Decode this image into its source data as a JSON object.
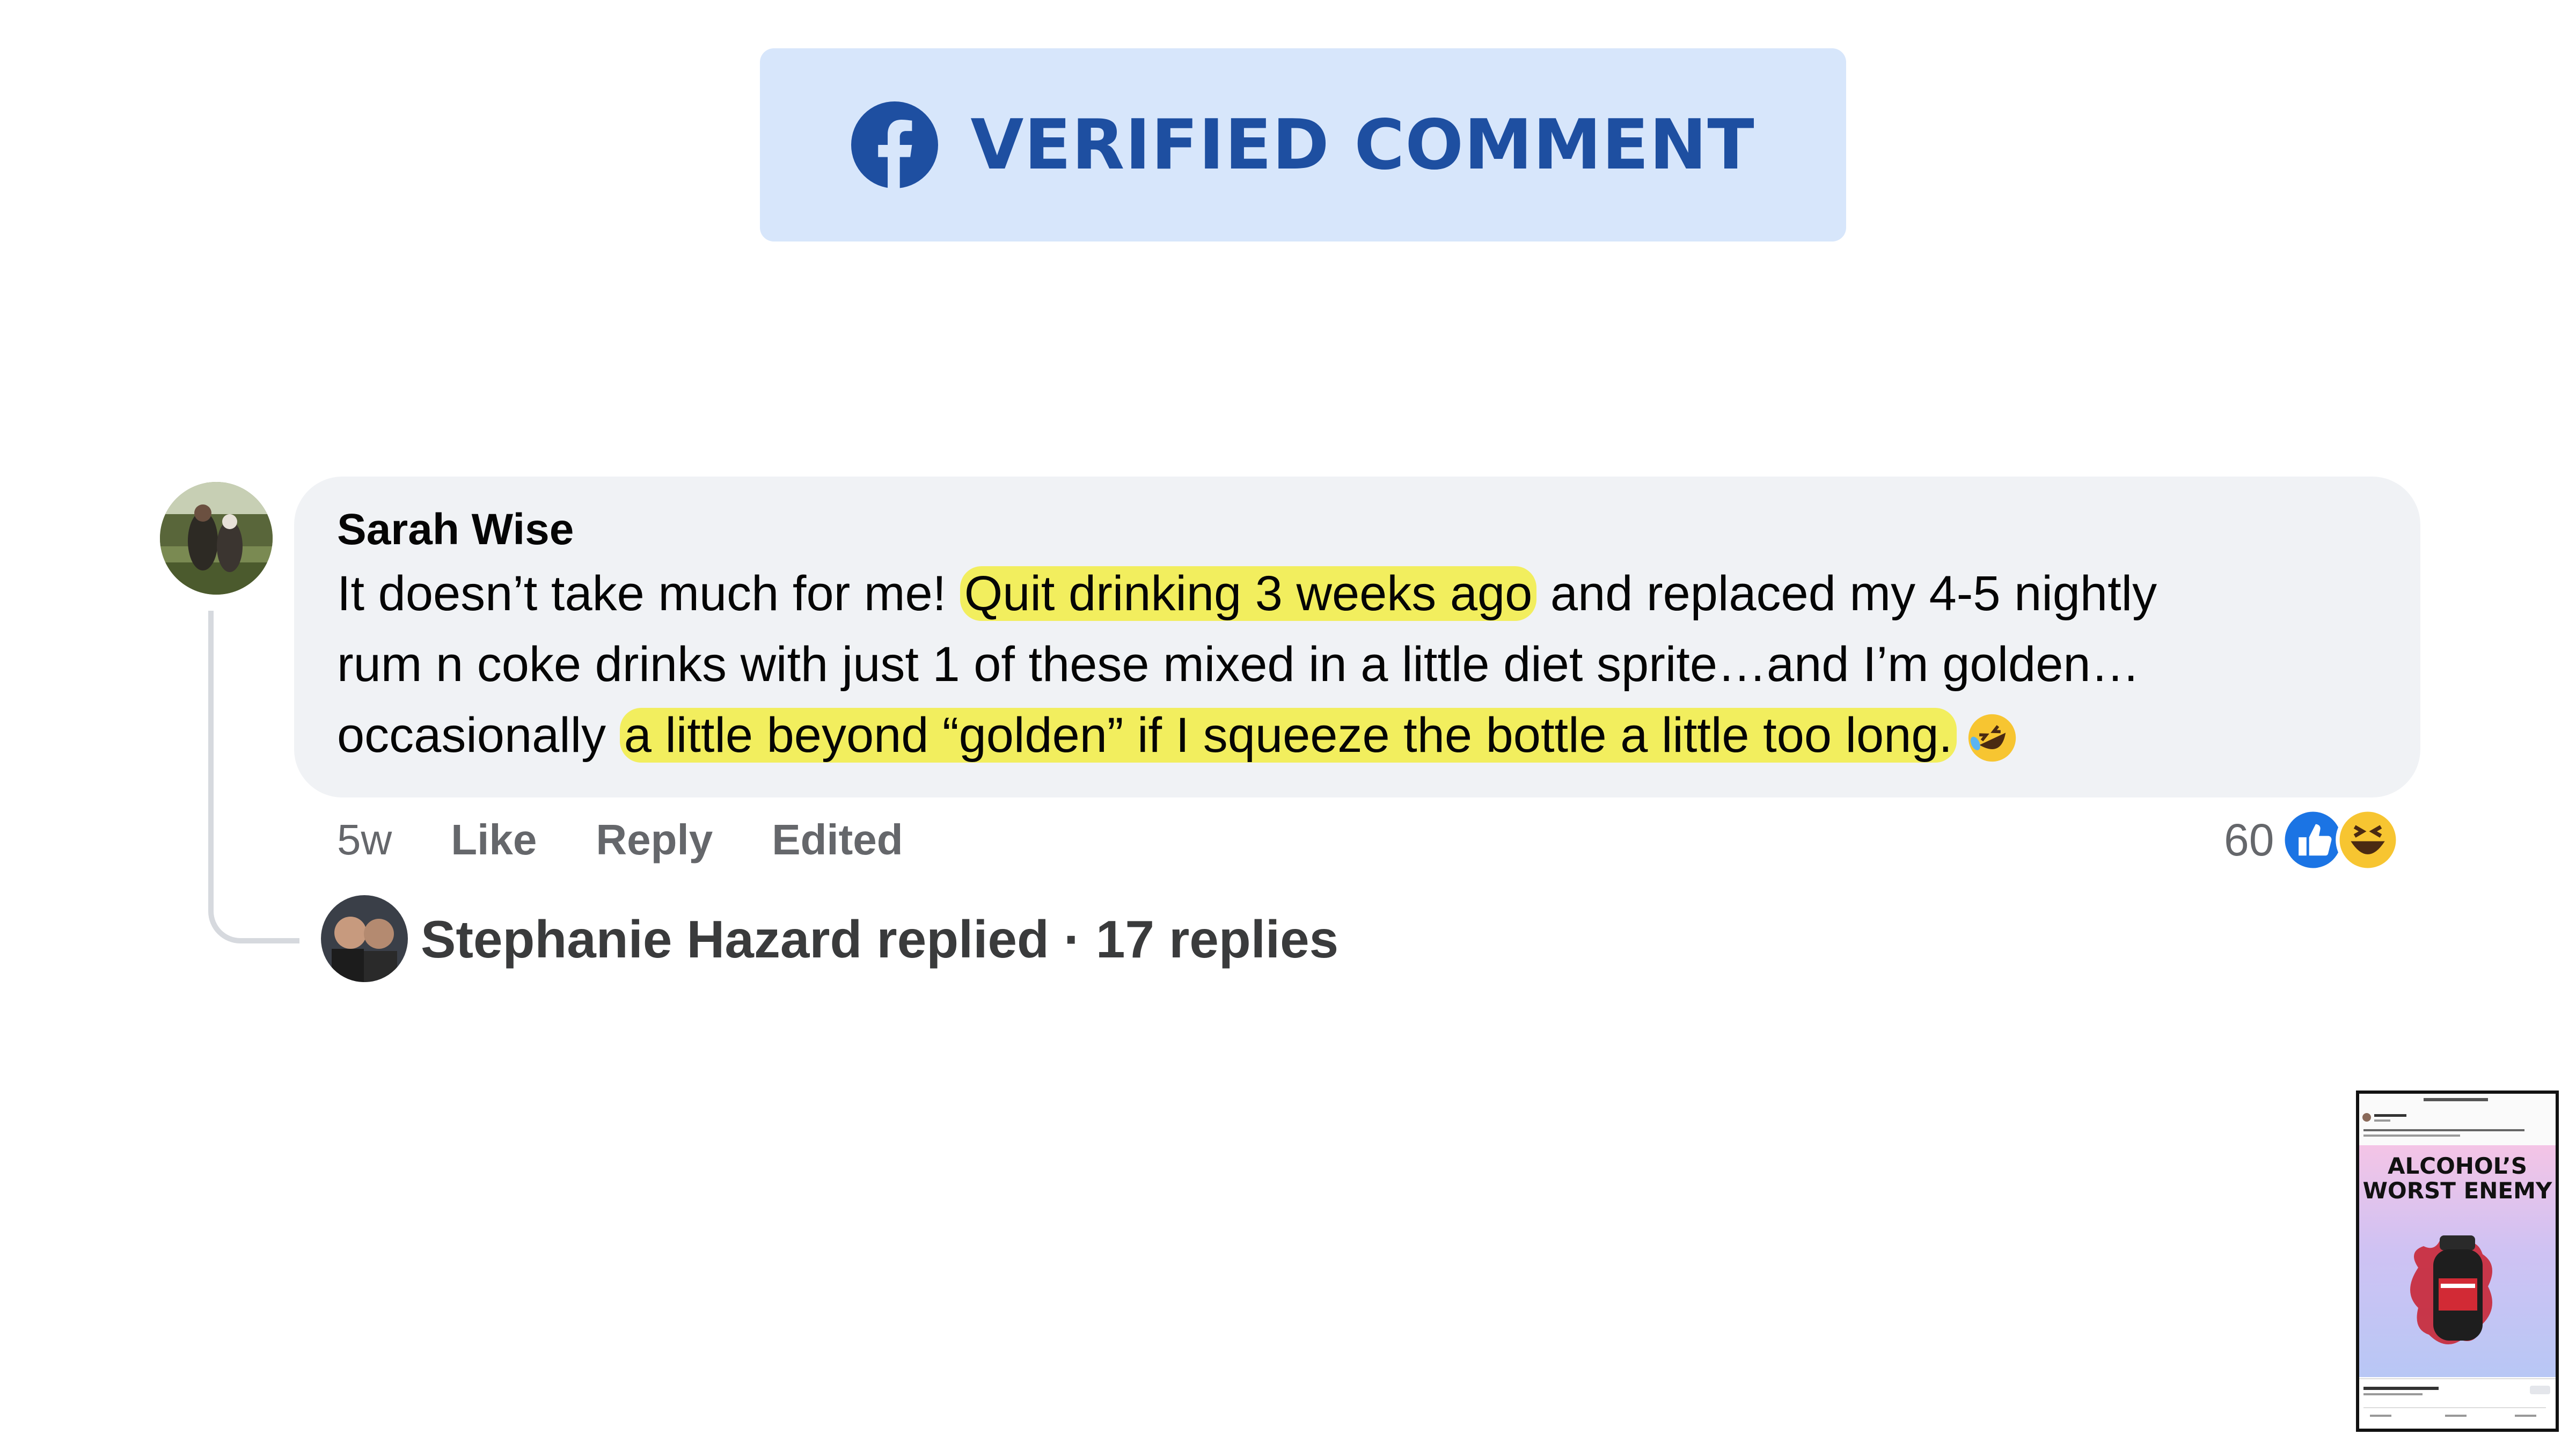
{
  "header": {
    "logo_icon": "facebook-logo-icon",
    "title": "VERIFIED COMMENT",
    "color_text": "#1e4fa1",
    "color_bg": "#d7e6fb"
  },
  "comment": {
    "author": "Sarah Wise",
    "line1_pre": "It doesn’t take much for me! ",
    "line1_hl": "Quit drinking 3 weeks ago",
    "line1_post": " and replaced my 4-5 nightly",
    "line2": "rum n coke drinks with just 1 of these mixed in a little diet sprite…and I’m golden…",
    "line3_pre": "occasionally ",
    "line3_hl": "a little beyond “golden” if I squeeze the bottle a little too long.",
    "emoji": "rolling-laughing-emoji-icon",
    "highlight_color": "#f2ee5e"
  },
  "actions": {
    "time": "5w",
    "like": "Like",
    "reply": "Reply",
    "edited": "Edited",
    "reaction_count": "60",
    "reaction_icons": [
      "like-reaction-icon",
      "haha-reaction-icon"
    ]
  },
  "replies": {
    "summary": "Stephanie Hazard replied · 17 replies"
  },
  "thumbnail": {
    "headline": "ALCOHOL’S WORST ENEMY"
  }
}
